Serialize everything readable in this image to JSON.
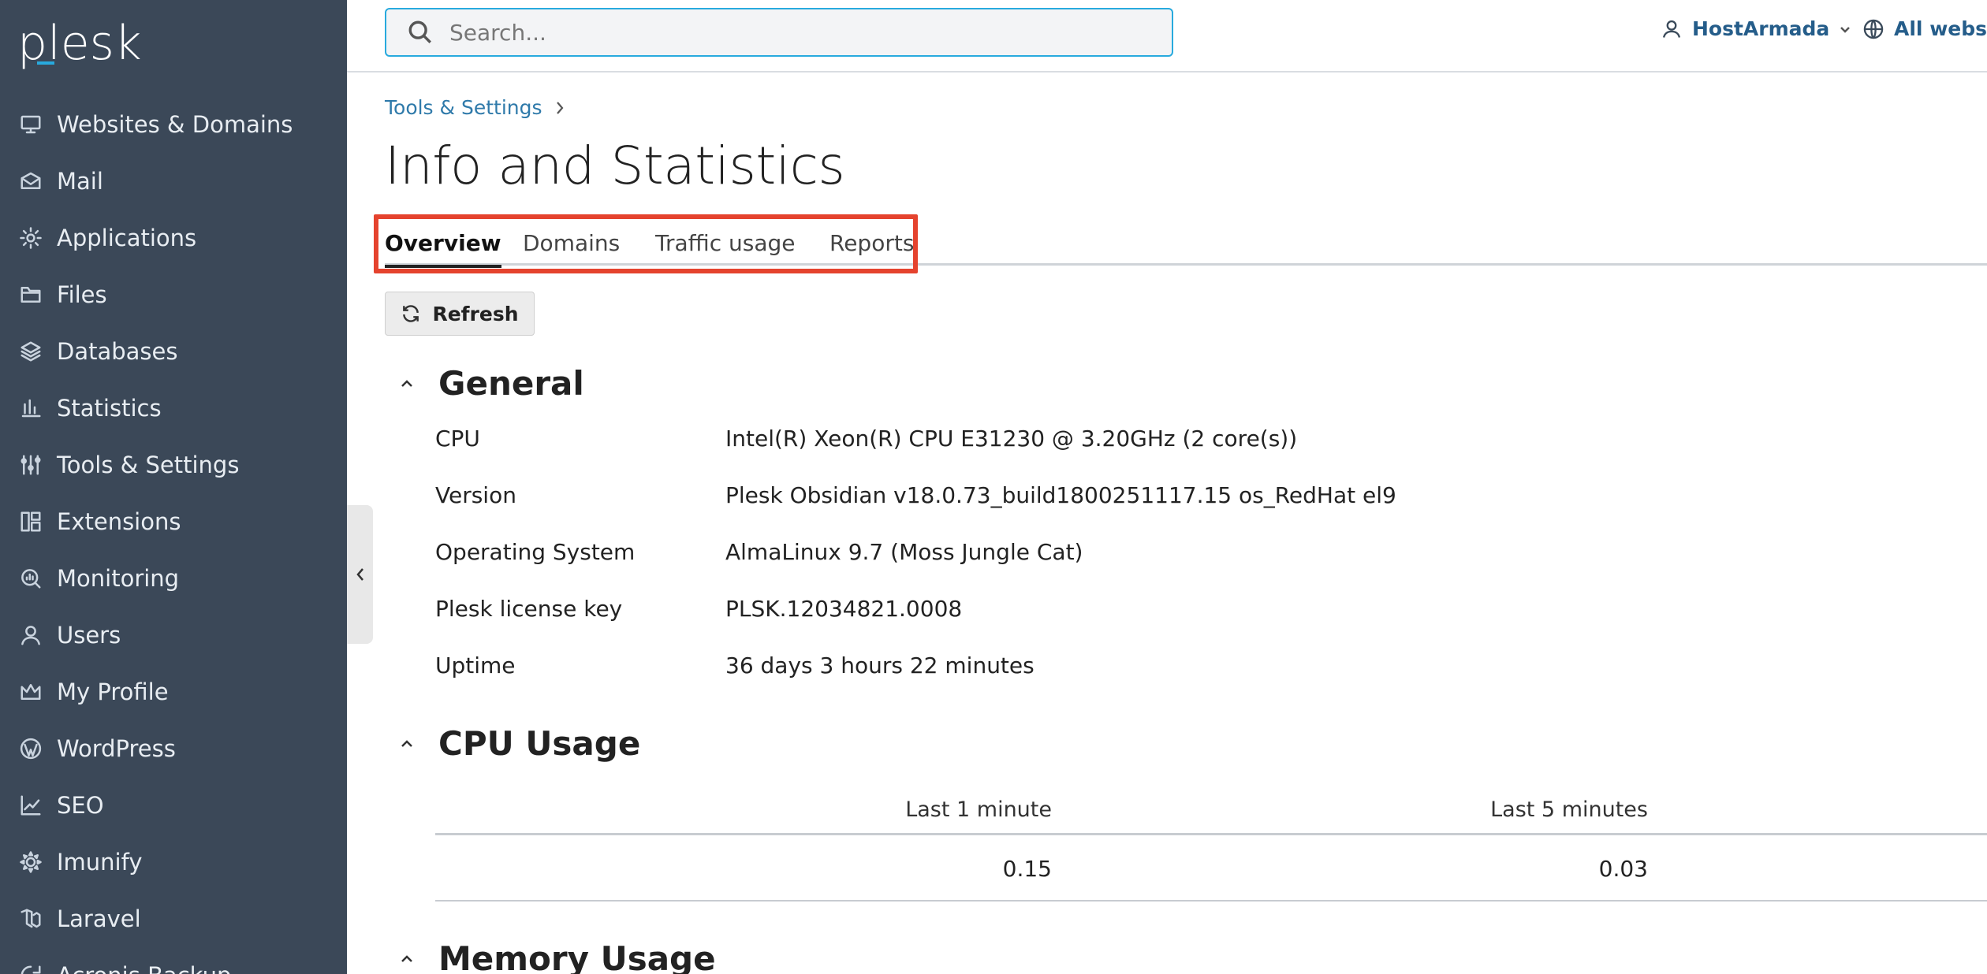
{
  "logo": "plesk",
  "sidebar": {
    "items": [
      {
        "label": "Websites & Domains",
        "icon": "monitor-icon"
      },
      {
        "label": "Mail",
        "icon": "mail-icon"
      },
      {
        "label": "Applications",
        "icon": "gear-icon"
      },
      {
        "label": "Files",
        "icon": "folder-icon"
      },
      {
        "label": "Databases",
        "icon": "layers-icon"
      },
      {
        "label": "Statistics",
        "icon": "bar-chart-icon"
      },
      {
        "label": "Tools & Settings",
        "icon": "sliders-icon"
      },
      {
        "label": "Extensions",
        "icon": "blocks-icon"
      },
      {
        "label": "Monitoring",
        "icon": "monitoring-icon"
      },
      {
        "label": "Users",
        "icon": "user-icon"
      },
      {
        "label": "My Profile",
        "icon": "crown-icon"
      },
      {
        "label": "WordPress",
        "icon": "wordpress-icon"
      },
      {
        "label": "SEO",
        "icon": "trend-chart-icon"
      },
      {
        "label": "Imunify",
        "icon": "cog-icon"
      },
      {
        "label": "Laravel",
        "icon": "laravel-icon"
      },
      {
        "label": "Acronis Backup",
        "icon": "backup-icon"
      }
    ]
  },
  "topbar": {
    "search_placeholder": "Search...",
    "user": "HostArmada",
    "webspaces": "All webspaces"
  },
  "breadcrumb": "Tools & Settings",
  "page_title": "Info and Statistics",
  "tabs": [
    "Overview",
    "Domains",
    "Traffic usage",
    "Reports"
  ],
  "active_tab": "Overview",
  "refresh_label": "Refresh",
  "general": {
    "title": "General",
    "rows": [
      {
        "key": "CPU",
        "value": "Intel(R) Xeon(R) CPU E31230 @ 3.20GHz (2 core(s))"
      },
      {
        "key": "Version",
        "value": "Plesk Obsidian v18.0.73_build1800251117.15 os_RedHat el9"
      },
      {
        "key": "Operating System",
        "value": "AlmaLinux 9.7 (Moss Jungle Cat)"
      },
      {
        "key": "Plesk license key",
        "value": "PLSK.12034821.0008"
      },
      {
        "key": "Uptime",
        "value": "36 days 3 hours 22 minutes"
      }
    ]
  },
  "cpu_usage": {
    "title": "CPU Usage",
    "columns": [
      "Last 1 minute",
      "Last 5 minutes"
    ],
    "values": [
      "0.15",
      "0.03"
    ]
  },
  "memory_usage": {
    "title": "Memory Usage"
  },
  "colors": {
    "sidebar_bg": "#3b4858",
    "accent": "#28aade",
    "highlight": "#e5432e",
    "link": "#2f7aaa"
  }
}
